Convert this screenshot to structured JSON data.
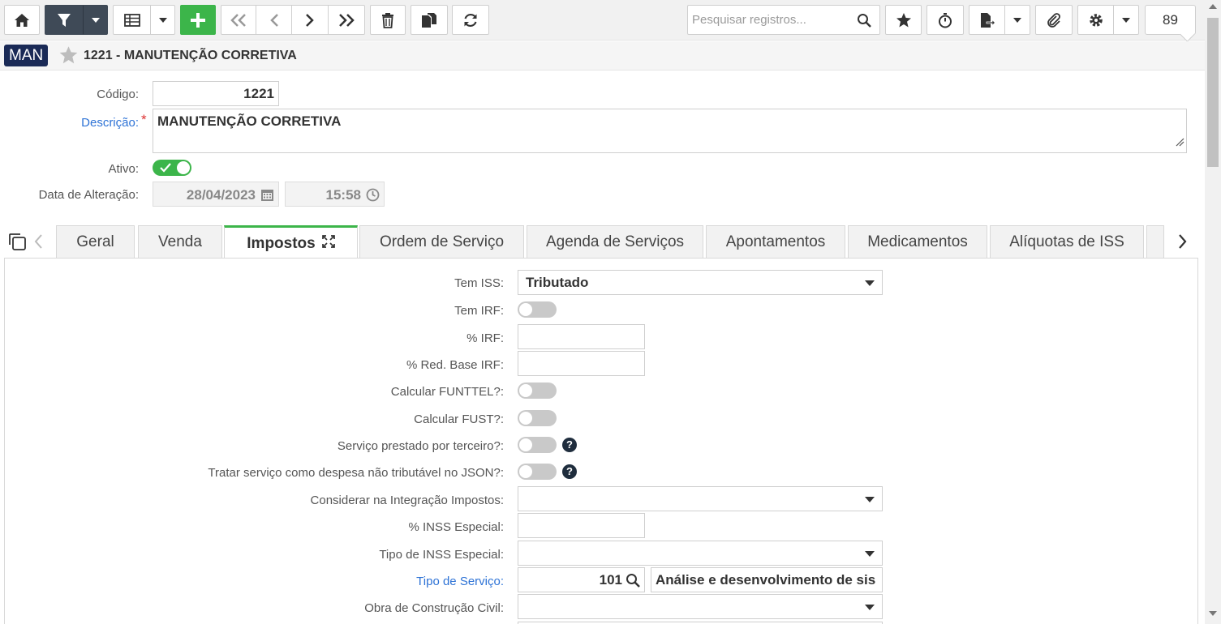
{
  "toolbar": {
    "search_placeholder": "Pesquisar registros...",
    "record_count": "89",
    "buttons": [
      "home-icon",
      "filter-icon",
      "grid-icon",
      "add-icon",
      "first-icon",
      "prev-icon",
      "next-icon",
      "last-icon",
      "delete-icon",
      "copy-icon",
      "refresh-icon",
      "favorite-icon",
      "timer-icon",
      "export-icon",
      "attach-icon",
      "settings-icon"
    ]
  },
  "header": {
    "module_badge": "MAN",
    "title": "1221 - MANUTENÇÃO CORRETIVA"
  },
  "form": {
    "codigo_label": "Código:",
    "codigo_value": "1221",
    "descricao_label": "Descrição:",
    "descricao_required": "*",
    "descricao_value": "MANUTENÇÃO CORRETIVA",
    "ativo_label": "Ativo:",
    "ativo_value": true,
    "data_alteracao_label": "Data de Alteração:",
    "data_value": "28/04/2023",
    "hora_value": "15:58"
  },
  "tabs": [
    {
      "label": "Geral",
      "active": false
    },
    {
      "label": "Venda",
      "active": false
    },
    {
      "label": "Impostos",
      "active": true
    },
    {
      "label": "Ordem de Serviço",
      "active": false
    },
    {
      "label": "Agenda de Serviços",
      "active": false
    },
    {
      "label": "Apontamentos",
      "active": false
    },
    {
      "label": "Medicamentos",
      "active": false
    },
    {
      "label": "Alíquotas de ISS",
      "active": false
    }
  ],
  "impostos": {
    "tem_iss_label": "Tem ISS:",
    "tem_iss_value": "Tributado",
    "tem_irf_label": "Tem IRF:",
    "tem_irf_value": false,
    "pct_irf_label": "% IRF:",
    "pct_irf_value": "",
    "pct_red_base_irf_label": "% Red. Base IRF:",
    "pct_red_base_irf_value": "",
    "calcular_funttel_label": "Calcular FUNTTEL?:",
    "calcular_funttel_value": false,
    "calcular_fust_label": "Calcular FUST?:",
    "calcular_fust_value": false,
    "servico_terceiro_label": "Serviço prestado por terceiro?:",
    "servico_terceiro_value": false,
    "tratar_despesa_label": "Tratar serviço como despesa não tributável no JSON?:",
    "tratar_despesa_value": false,
    "integracao_impostos_label": "Considerar na Integração Impostos:",
    "integracao_impostos_value": "",
    "pct_inss_especial_label": "% INSS Especial:",
    "pct_inss_especial_value": "",
    "tipo_inss_especial_label": "Tipo de INSS Especial:",
    "tipo_inss_especial_value": "",
    "tipo_servico_label": "Tipo de Serviço:",
    "tipo_servico_code": "101",
    "tipo_servico_desc": "Análise e desenvolvimento de sis",
    "obra_construcao_label": "Obra de Construção Civil:",
    "obra_construcao_value": ""
  },
  "colors": {
    "accent_green": "#3cb54a",
    "badge_navy": "#1a2a56",
    "link_blue": "#2e73d6",
    "toolbar_dark": "#3f4a57"
  }
}
